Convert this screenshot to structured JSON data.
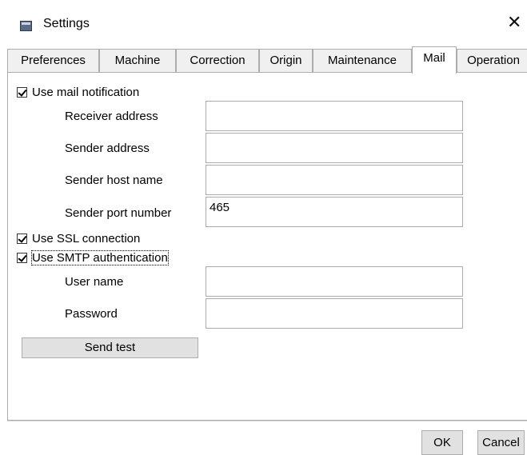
{
  "window": {
    "title": "Settings",
    "close_symbol": "✕",
    "icon": "settings-window-icon"
  },
  "tabs": [
    {
      "label": "Preferences"
    },
    {
      "label": "Machine"
    },
    {
      "label": "Correction"
    },
    {
      "label": "Origin"
    },
    {
      "label": "Maintenance"
    },
    {
      "label": "Mail",
      "active": true
    },
    {
      "label": "Operation"
    }
  ],
  "mail": {
    "use_mail_notification": {
      "label": "Use mail notification",
      "checked": true
    },
    "receiver_address": {
      "label": "Receiver address",
      "value": ""
    },
    "sender_address": {
      "label": "Sender address",
      "value": ""
    },
    "sender_host_name": {
      "label": "Sender host name",
      "value": ""
    },
    "sender_port_number": {
      "label": "Sender port number",
      "value": "465"
    },
    "use_ssl": {
      "label": "Use SSL connection",
      "checked": true
    },
    "use_smtp_auth": {
      "label": "Use SMTP authentication",
      "checked": true
    },
    "user_name": {
      "label": "User name",
      "value": ""
    },
    "password": {
      "label": "Password",
      "value": ""
    },
    "send_test_label": "Send test"
  },
  "footer": {
    "ok_label": "OK",
    "cancel_label": "Cancel"
  }
}
